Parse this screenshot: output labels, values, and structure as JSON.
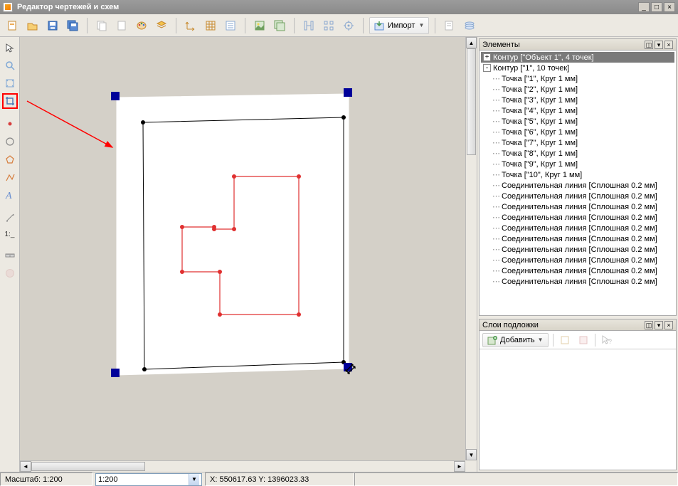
{
  "window": {
    "title": "Редактор чертежей и схем"
  },
  "toolbar": {
    "import_label": "Импорт"
  },
  "side_tools": {
    "scale_text": "1:_"
  },
  "right_panels": {
    "elements_title": "Элементы",
    "layers_title": "Слои подложки",
    "add_label": "Добавить"
  },
  "tree": {
    "root1": "Контур [\"Объект 1\", 4 точек]",
    "root2": "Контур [\"1\", 10 точек]",
    "points": [
      "Точка [\"1\", Круг 1 мм]",
      "Точка [\"2\", Круг 1 мм]",
      "Точка [\"3\", Круг 1 мм]",
      "Точка [\"4\", Круг 1 мм]",
      "Точка [\"5\", Круг 1 мм]",
      "Точка [\"6\", Круг 1 мм]",
      "Точка [\"7\", Круг 1 мм]",
      "Точка [\"8\", Круг 1 мм]",
      "Точка [\"9\", Круг 1 мм]",
      "Точка [\"10\", Круг 1 мм]"
    ],
    "lines": [
      "Соединительная линия [Сплошная 0.2 мм]",
      "Соединительная линия [Сплошная 0.2 мм]",
      "Соединительная линия [Сплошная 0.2 мм]",
      "Соединительная линия [Сплошная 0.2 мм]",
      "Соединительная линия [Сплошная 0.2 мм]",
      "Соединительная линия [Сплошная 0.2 мм]",
      "Соединительная линия [Сплошная 0.2 мм]",
      "Соединительная линия [Сплошная 0.2 мм]",
      "Соединительная линия [Сплошная 0.2 мм]",
      "Соединительная линия [Сплошная 0.2 мм]"
    ]
  },
  "status": {
    "scale_label": "Масштаб: 1:200",
    "scale_value": "1:200",
    "coords": "X: 550617.63 Y: 1396023.33"
  }
}
